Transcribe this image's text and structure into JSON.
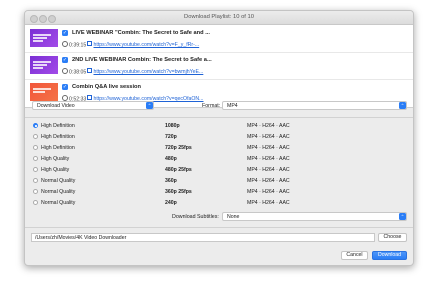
{
  "window": {
    "title": "Download Playlist: 10 of 10"
  },
  "playlist": [
    {
      "title": "LIVE WEBINAR \"Combin: The Secret to Safe and ...",
      "duration": "0:39:15",
      "url": "https://www.youtube.com/watch?v=F_y_fRr-...",
      "thumb_color": "purple"
    },
    {
      "title": "2ND LIVE WEBINAR Combin: The Secret to Safe a...",
      "duration": "0:38:05",
      "url": "https://www.youtube.com/watch?v=bwmjhYeE...",
      "thumb_color": "purple"
    },
    {
      "title": "Combin Q&A live session",
      "duration": "0:52:33",
      "url": "https://www.youtube.com/watch?v=qecOfaON...",
      "thumb_color": "orange"
    }
  ],
  "mode_select": "Download Video",
  "format_label": "Format:",
  "format_select": "MP4",
  "quality_options": [
    {
      "quality": "High Definition",
      "resolution": "1080p",
      "format": "MP4 · H264 · AAC",
      "selected": true
    },
    {
      "quality": "High Definition",
      "resolution": "720p",
      "format": "MP4 · H264 · AAC",
      "selected": false
    },
    {
      "quality": "High Definition",
      "resolution": "720p 25fps",
      "format": "MP4 · H264 · AAC",
      "selected": false
    },
    {
      "quality": "High Quality",
      "resolution": "480p",
      "format": "MP4 · H264 · AAC",
      "selected": false
    },
    {
      "quality": "High Quality",
      "resolution": "480p 25fps",
      "format": "MP4 · H264 · AAC",
      "selected": false
    },
    {
      "quality": "Normal Quality",
      "resolution": "360p",
      "format": "MP4 · H264 · AAC",
      "selected": false
    },
    {
      "quality": "Normal Quality",
      "resolution": "360p 25fps",
      "format": "MP4 · H264 · AAC",
      "selected": false
    },
    {
      "quality": "Normal Quality",
      "resolution": "240p",
      "format": "MP4 · H264 · AAC",
      "selected": false
    }
  ],
  "subtitles_label": "Download Subtitles:",
  "subtitles_select": "None",
  "path": "/Users/zh/Movies/4K Video Downloader",
  "choose_label": "Choose",
  "cancel_label": "Cancel",
  "download_label": "Download",
  "colors": {
    "accent": "#2a7df6",
    "link": "#1f63d6"
  }
}
